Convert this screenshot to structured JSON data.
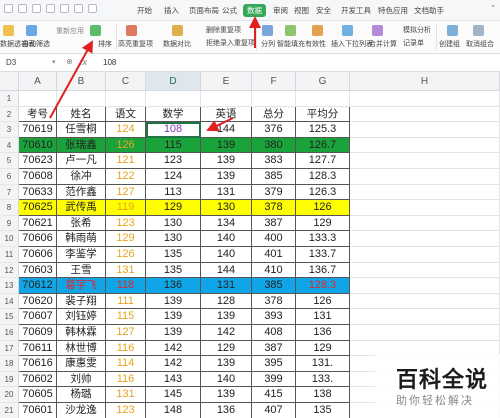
{
  "ribbon_tabs": [
    "开始",
    "插入",
    "页面布局",
    "公式",
    "数据",
    "审阅",
    "视图",
    "安全",
    "开发工具",
    "特色应用",
    "文档助手"
  ],
  "active_tab": "数据",
  "ribbon_buttons": [
    "数据透视表",
    "自动筛选",
    "重新应用",
    "排序",
    "高亮重复项",
    "数据对比",
    "删除重复项",
    "拒绝录入重复项",
    "分列",
    "智能填充",
    "有效性",
    "插入下拉列表",
    "合并计算",
    "模拟分析",
    "记录单",
    "创建组",
    "取消组合"
  ],
  "formula_bar": {
    "cell_ref": "D3",
    "fx": "fx",
    "value": "108"
  },
  "columns": [
    "A",
    "B",
    "C",
    "D",
    "E",
    "F",
    "G",
    "H"
  ],
  "selected_column": "D",
  "header_row": [
    "考号",
    "姓名",
    "语文",
    "数学",
    "英语",
    "总分",
    "平均分"
  ],
  "rows": [
    {
      "n": "1",
      "cells": [
        "",
        "",
        "",
        "",
        "",
        "",
        ""
      ],
      "hl": ""
    },
    {
      "n": "2",
      "cells": [
        "考号",
        "姓名",
        "语文",
        "数学",
        "英语",
        "总分",
        "平均分"
      ],
      "hl": "header"
    },
    {
      "n": "3",
      "cells": [
        "70619",
        "任雪桐",
        "124",
        "108",
        "144",
        "376",
        "125.3"
      ],
      "hl": ""
    },
    {
      "n": "4",
      "cells": [
        "70610",
        "张瑞鑫",
        "126",
        "115",
        "139",
        "380",
        "126.7"
      ],
      "hl": "green"
    },
    {
      "n": "5",
      "cells": [
        "70623",
        "卢一凡",
        "121",
        "123",
        "139",
        "383",
        "127.7"
      ],
      "hl": ""
    },
    {
      "n": "6",
      "cells": [
        "70608",
        "徐冲",
        "122",
        "124",
        "139",
        "385",
        "128.3"
      ],
      "hl": ""
    },
    {
      "n": "7",
      "cells": [
        "70633",
        "范作鑫",
        "127",
        "113",
        "131",
        "379",
        "126.3"
      ],
      "hl": ""
    },
    {
      "n": "8",
      "cells": [
        "70625",
        "武传禹",
        "119",
        "129",
        "130",
        "378",
        "126"
      ],
      "hl": "yellow"
    },
    {
      "n": "9",
      "cells": [
        "70621",
        "张希",
        "123",
        "130",
        "134",
        "387",
        "129"
      ],
      "hl": ""
    },
    {
      "n": "10",
      "cells": [
        "70606",
        "韩雨萌",
        "129",
        "130",
        "140",
        "400",
        "133.3"
      ],
      "hl": ""
    },
    {
      "n": "11",
      "cells": [
        "70606",
        "李鉴学",
        "126",
        "135",
        "140",
        "401",
        "133.7"
      ],
      "hl": ""
    },
    {
      "n": "12",
      "cells": [
        "70603",
        "王雪",
        "131",
        "135",
        "144",
        "410",
        "136.7"
      ],
      "hl": ""
    },
    {
      "n": "13",
      "cells": [
        "70612",
        "葛宇飞",
        "118",
        "136",
        "131",
        "385",
        "128.3"
      ],
      "hl": "blue"
    },
    {
      "n": "14",
      "cells": [
        "70620",
        "裴子翔",
        "111",
        "139",
        "128",
        "378",
        "126"
      ],
      "hl": ""
    },
    {
      "n": "15",
      "cells": [
        "70607",
        "刘钰婷",
        "115",
        "139",
        "139",
        "393",
        "131"
      ],
      "hl": ""
    },
    {
      "n": "16",
      "cells": [
        "70609",
        "韩林霖",
        "127",
        "139",
        "142",
        "408",
        "136"
      ],
      "hl": ""
    },
    {
      "n": "17",
      "cells": [
        "70611",
        "林世博",
        "116",
        "142",
        "129",
        "387",
        "129"
      ],
      "hl": ""
    },
    {
      "n": "18",
      "cells": [
        "70616",
        "康惠雯",
        "114",
        "142",
        "139",
        "395",
        "131."
      ],
      "hl": ""
    },
    {
      "n": "19",
      "cells": [
        "70602",
        "刘帅",
        "116",
        "143",
        "140",
        "399",
        "133."
      ],
      "hl": ""
    },
    {
      "n": "20",
      "cells": [
        "70605",
        "杨璐",
        "131",
        "145",
        "139",
        "415",
        "138"
      ],
      "hl": ""
    },
    {
      "n": "21",
      "cells": [
        "70601",
        "沙龙逸",
        "123",
        "148",
        "136",
        "407",
        "135"
      ],
      "hl": ""
    }
  ],
  "watermark": {
    "main": "百科全说",
    "sub": "助你轻松解决"
  },
  "colors": {
    "accent": "#217346",
    "highlight_green": "#1aa33a",
    "highlight_yellow": "#ffff00",
    "highlight_blue": "#10a5e6",
    "score_orange": "#e8a31c",
    "arrow_red": "#e02020"
  }
}
